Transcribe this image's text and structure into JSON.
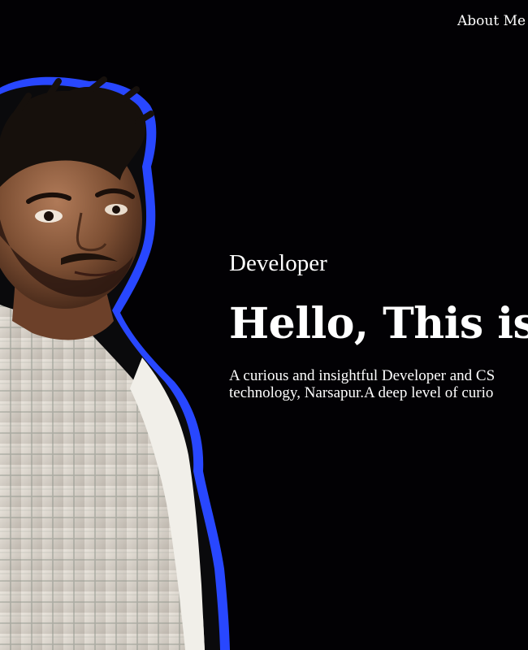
{
  "nav": {
    "about_label": "About Me"
  },
  "portrait": {
    "outline_color": "#2847ff",
    "icon": "person-portrait"
  },
  "hero": {
    "role": "Developer",
    "headline": "Hello, This is",
    "bio": "A curious and insightful Developer and CS\ntechnology, Narsapur.A deep level of curio"
  }
}
